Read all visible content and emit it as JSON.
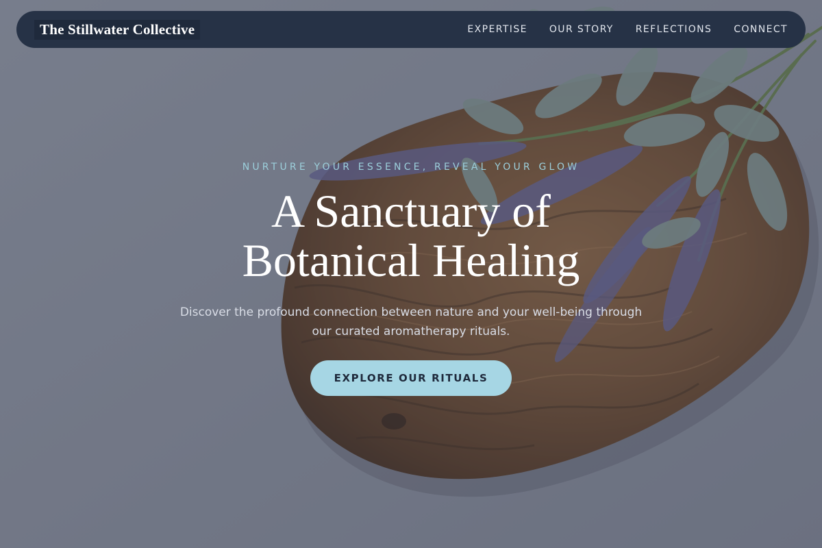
{
  "brand": {
    "name": "The Stillwater Collective"
  },
  "nav": {
    "items": [
      {
        "label": "EXPERTISE"
      },
      {
        "label": "OUR STORY"
      },
      {
        "label": "REFLECTIONS"
      },
      {
        "label": "CONNECT"
      }
    ]
  },
  "hero": {
    "eyebrow": "NURTURE YOUR ESSENCE, REVEAL YOUR GLOW",
    "headline_line1": "A Sanctuary of",
    "headline_line2": "Botanical Healing",
    "subtext": "Discover the profound connection between nature and your well-being through our curated aromatherapy rituals.",
    "cta_label": "EXPLORE OUR RITUALS",
    "background_image": "lavender-sprigs-on-olive-wood-board"
  },
  "colors": {
    "nav_bg": "#263246",
    "eyebrow": "#9ccfdb",
    "cta_bg": "#a6d6e4",
    "cta_text": "#1f2a3c",
    "headline": "#ffffff"
  }
}
